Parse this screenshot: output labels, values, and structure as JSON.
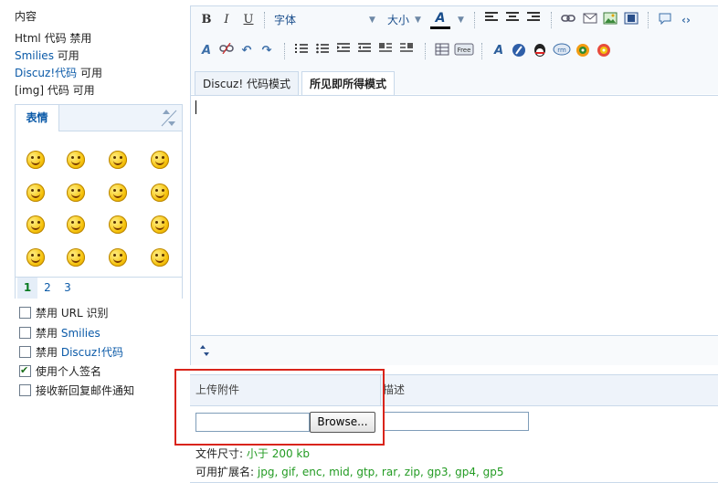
{
  "left": {
    "content_label": "内容",
    "html_line": {
      "label": "Html 代码",
      "value": "禁用"
    },
    "smilies_line": {
      "label": "Smilies",
      "value": "可用"
    },
    "discuz_line": {
      "label": "Discuz!代码",
      "value": "可用"
    },
    "img_line": {
      "label": "[img] 代码",
      "value": "可用"
    }
  },
  "smilies": {
    "tab_label": "表情",
    "pages": [
      "1",
      "2",
      "3"
    ],
    "current_page": "1"
  },
  "options": [
    {
      "prefix": "禁用 ",
      "text": "URL 识别",
      "link": false,
      "checked": false
    },
    {
      "prefix": "禁用 ",
      "text": "Smilies",
      "link": true,
      "checked": false
    },
    {
      "prefix": "禁用 ",
      "text": "Discuz!代码",
      "link": true,
      "checked": false
    },
    {
      "prefix": "",
      "text": "使用个人签名",
      "link": false,
      "checked": true
    },
    {
      "prefix": "",
      "text": "接收新回复邮件通知",
      "link": false,
      "checked": false
    }
  ],
  "toolbar": {
    "bold": "B",
    "italic": "I",
    "underline": "U",
    "font_label": "字体",
    "size_label": "大小",
    "color_label": "A"
  },
  "editor": {
    "tab_code_mode": "Discuz! 代码模式",
    "tab_wysiwyg_mode": "所见即所得模式",
    "active_tab": "所见即所得模式"
  },
  "attachment": {
    "col_upload": "上传附件",
    "col_desc": "描述",
    "browse_label": "Browse...",
    "size_label": "文件尺寸:",
    "size_value": "小于 200 kb",
    "ext_label": "可用扩展名:",
    "ext_value": "jpg, gif, enc, mid, gtp, rar, zip, gp3, gp4, gp5"
  },
  "colors": {
    "link": "#0b5aa8",
    "green": "#239b23",
    "border": "#c9d9ea",
    "highlight_box": "#d9241b"
  }
}
